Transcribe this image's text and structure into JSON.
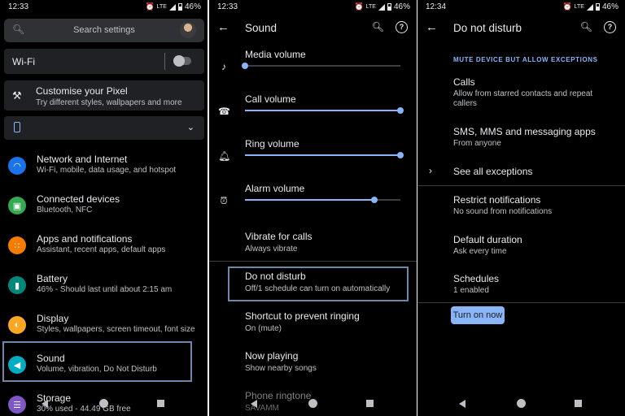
{
  "screen1": {
    "status": {
      "time": "12:33",
      "network": "LTE",
      "battery": "46%"
    },
    "search_placeholder": "Search settings",
    "wifi": {
      "label": "Wi-Fi",
      "enabled": false
    },
    "suggestion": {
      "title": "Customise your Pixel",
      "subtitle": "Try different styles, wallpapers and more"
    },
    "items": [
      {
        "title": "Network and Internet",
        "subtitle": "Wi-Fi, mobile, data usage, and hotspot",
        "icon": "wifi-icon",
        "color": "#1a73e8"
      },
      {
        "title": "Connected devices",
        "subtitle": "Bluetooth, NFC",
        "icon": "devices-icon",
        "color": "#34a853"
      },
      {
        "title": "Apps and notifications",
        "subtitle": "Assistant, recent apps, default apps",
        "icon": "apps-icon",
        "color": "#f57c00"
      },
      {
        "title": "Battery",
        "subtitle": "46% - Should last until about 2:15 am",
        "icon": "battery-icon",
        "color": "#00897b"
      },
      {
        "title": "Display",
        "subtitle": "Styles, wallpapers, screen timeout, font size",
        "icon": "display-icon",
        "color": "#f9a825"
      },
      {
        "title": "Sound",
        "subtitle": "Volume, vibration, Do Not Disturb",
        "icon": "sound-icon",
        "color": "#00acc1"
      },
      {
        "title": "Storage",
        "subtitle": "30% used - 44.49 GB free",
        "icon": "storage-icon",
        "color": "#7e57c2"
      }
    ]
  },
  "screen2": {
    "status": {
      "time": "12:33",
      "network": "LTE",
      "battery": "46%"
    },
    "title": "Sound",
    "volumes": [
      {
        "label": "Media volume",
        "icon": "music-note-icon",
        "level": 0.0
      },
      {
        "label": "Call volume",
        "icon": "phone-icon",
        "level": 1.0
      },
      {
        "label": "Ring volume",
        "icon": "bell-icon",
        "level": 1.0
      },
      {
        "label": "Alarm volume",
        "icon": "alarm-icon",
        "level": 0.83
      }
    ],
    "items": [
      {
        "title": "Vibrate for calls",
        "subtitle": "Always vibrate"
      },
      {
        "title": "Do not disturb",
        "subtitle": "Off/1 schedule can turn on automatically"
      },
      {
        "title": "Shortcut to prevent ringing",
        "subtitle": "On (mute)"
      },
      {
        "title": "Now playing",
        "subtitle": "Show nearby songs"
      },
      {
        "title": "Phone ringtone",
        "subtitle": "SAVAMM"
      }
    ]
  },
  "screen3": {
    "status": {
      "time": "12:34",
      "network": "LTE",
      "battery": "46%"
    },
    "title": "Do not disturb",
    "section_header": "MUTE DEVICE BUT ALLOW EXCEPTIONS",
    "items": [
      {
        "title": "Calls",
        "subtitle": "Allow from starred contacts and repeat callers"
      },
      {
        "title": "SMS, MMS and messaging apps",
        "subtitle": "From anyone"
      },
      {
        "title": "See all exceptions",
        "subtitle": ""
      },
      {
        "title": "Restrict notifications",
        "subtitle": "No sound from notifications"
      },
      {
        "title": "Default duration",
        "subtitle": "Ask every time"
      },
      {
        "title": "Schedules",
        "subtitle": "1 enabled"
      }
    ],
    "turn_on_label": "Turn on now"
  }
}
